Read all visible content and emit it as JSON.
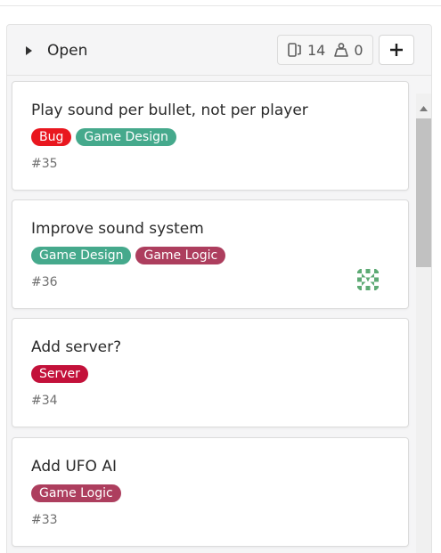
{
  "list": {
    "title": "Open",
    "issue_count": "14",
    "assignee_count": "0",
    "add_button_label": "+"
  },
  "cards": [
    {
      "title": "Play sound per bullet, not per player",
      "labels": [
        {
          "text": "Bug",
          "color": "#e9171f"
        },
        {
          "text": "Game Design",
          "color": "#45a98c"
        }
      ],
      "number": "#35",
      "has_avatar": false
    },
    {
      "title": "Improve sound system",
      "labels": [
        {
          "text": "Game Design",
          "color": "#45a98c"
        },
        {
          "text": "Game Logic",
          "color": "#ad3e5e"
        }
      ],
      "number": "#36",
      "has_avatar": true
    },
    {
      "title": "Add server?",
      "labels": [
        {
          "text": "Server",
          "color": "#c3113a"
        }
      ],
      "number": "#34",
      "has_avatar": false
    },
    {
      "title": "Add UFO AI",
      "labels": [
        {
          "text": "Game Logic",
          "color": "#ad3e5e"
        }
      ],
      "number": "#33",
      "has_avatar": false
    }
  ],
  "colors": {
    "avatar": "#5daa74"
  }
}
